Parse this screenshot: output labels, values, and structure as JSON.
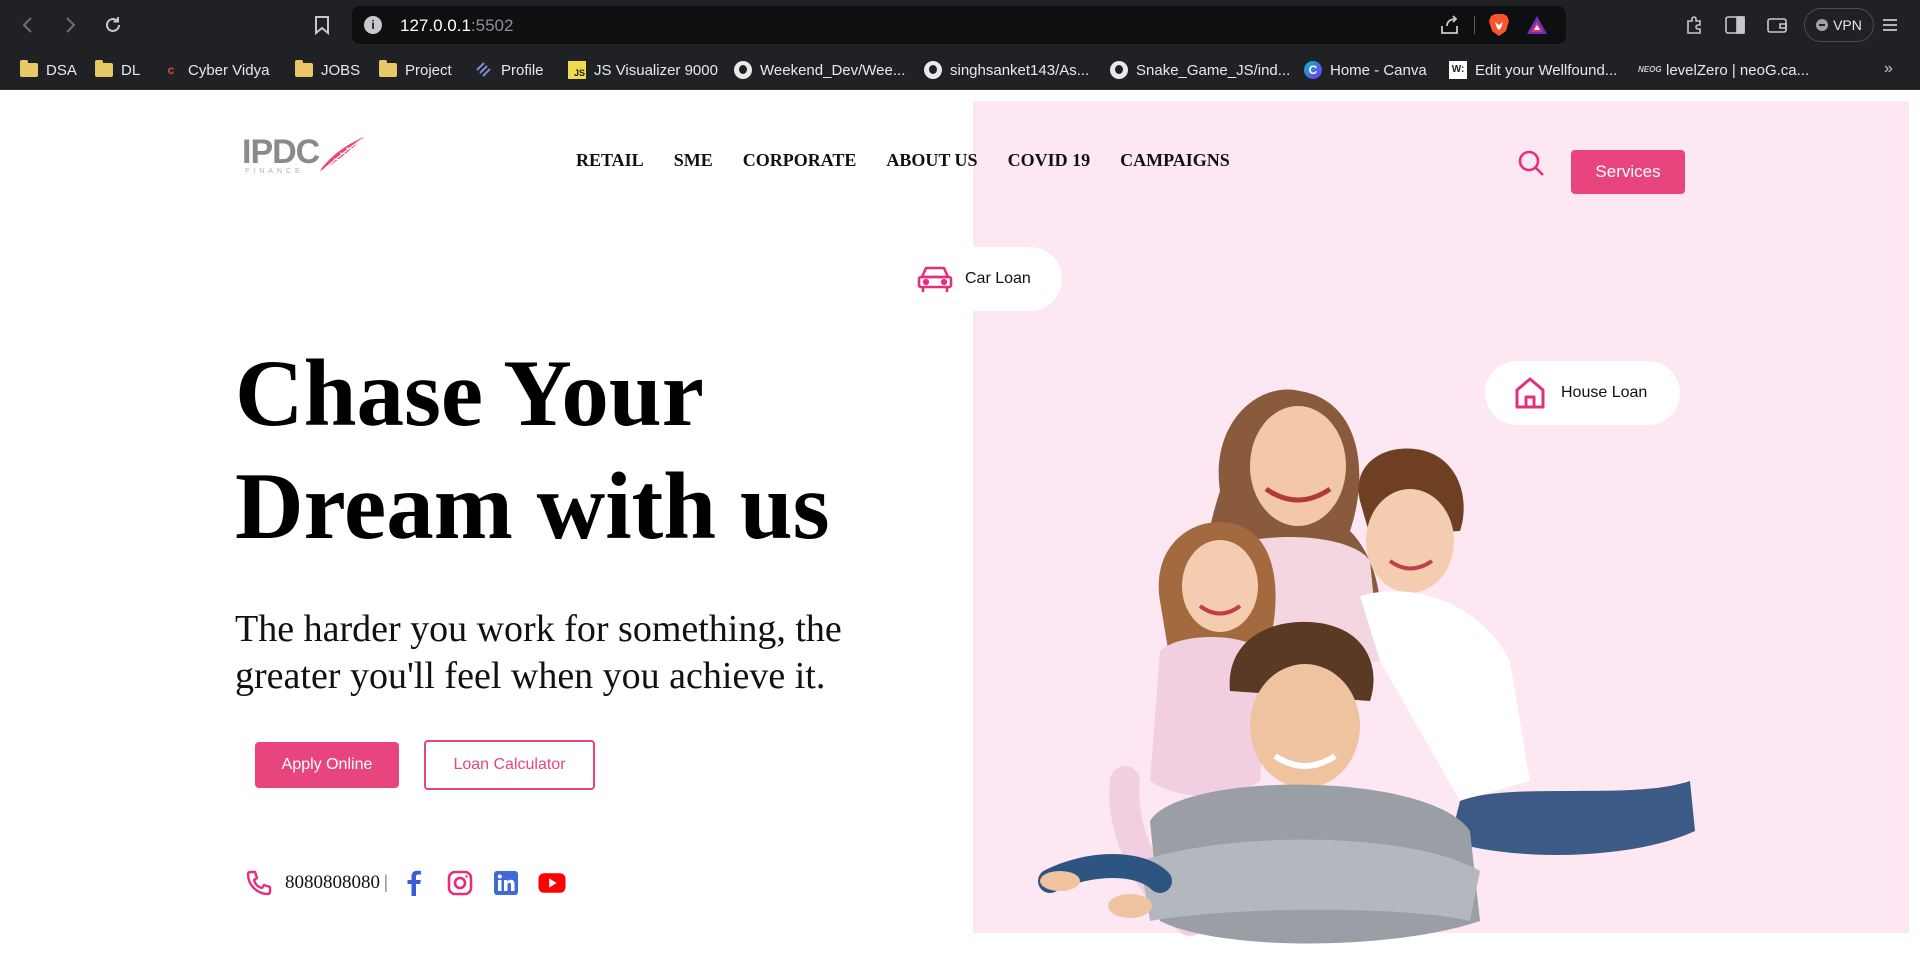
{
  "browser": {
    "url_host": "127.0.0.1",
    "url_port": ":5502",
    "vpn_label": "VPN",
    "bookmarks": [
      {
        "label": "DSA",
        "icon": "folder-icon"
      },
      {
        "label": "DL",
        "icon": "folder-icon"
      },
      {
        "label": "Cyber Vidya",
        "icon": "cyber-vidya-icon"
      },
      {
        "label": "JOBS",
        "icon": "folder-icon"
      },
      {
        "label": "Project",
        "icon": "folder-icon"
      },
      {
        "label": "Profile",
        "icon": "profile-icon"
      },
      {
        "label": "JS Visualizer 9000",
        "icon": "js-icon"
      },
      {
        "label": "Weekend_Dev/Wee...",
        "icon": "github-icon"
      },
      {
        "label": "singhsanket143/As...",
        "icon": "github-icon"
      },
      {
        "label": "Snake_Game_JS/ind...",
        "icon": "github-icon"
      },
      {
        "label": "Home - Canva",
        "icon": "canva-icon"
      },
      {
        "label": "Edit your Wellfound...",
        "icon": "wellfound-icon"
      },
      {
        "label": "levelZero | neoG.ca...",
        "icon": "neog-icon"
      }
    ],
    "more_label": "»"
  },
  "site": {
    "logo_text": "IPDC",
    "logo_sub": "FINANCE",
    "nav": [
      "RETAIL",
      "SME",
      "CORPORATE",
      "ABOUT US",
      "COVID 19",
      "CAMPAIGNS"
    ],
    "services_label": "Services",
    "car_loan_label": "Car Loan",
    "house_loan_label": "House Loan",
    "hero_title": "Chase Your Dream with us",
    "hero_subtitle": "The harder you work for something, the greater you'll feel when you achieve it.",
    "apply_label": "Apply Online",
    "calculator_label": "Loan Calculator",
    "phone": "8080808080",
    "phone_separator": "|",
    "socials": [
      "facebook-icon",
      "instagram-icon",
      "linkedin-icon",
      "youtube-icon"
    ]
  },
  "colors": {
    "brand_pink": "#e8457f",
    "panel_pink": "#fde7f2",
    "chrome_dark": "#202124"
  }
}
